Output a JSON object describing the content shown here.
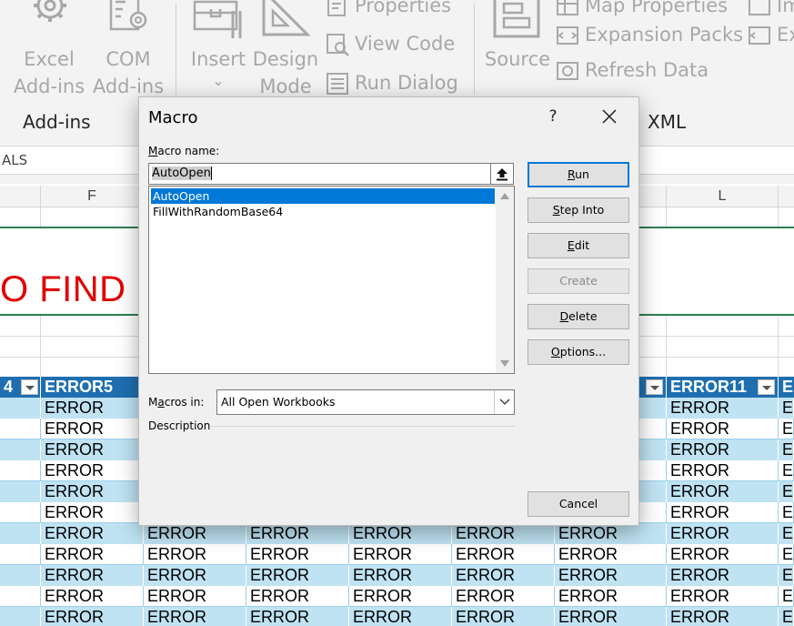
{
  "ribbon": {
    "big_buttons": [
      {
        "line1": "Excel",
        "line2": "Add-ins",
        "icon": "gear-icon"
      },
      {
        "line1": "COM",
        "line2": "Add-ins",
        "icon": "com-gear-icon"
      },
      {
        "line1": "Insert",
        "line2": "⌄",
        "icon": "toolbox-icon"
      },
      {
        "line1": "Design",
        "line2": "Mode",
        "icon": "design-mode-icon"
      },
      {
        "line1": "Source",
        "line2": "",
        "icon": "xml-source-icon"
      }
    ],
    "small_buttons": {
      "properties": "Properties",
      "view_code": "View Code",
      "run_dialog": "Run Dialog",
      "map_properties": "Map Properties",
      "expansion_packs": "Expansion Packs",
      "refresh_data": "Refresh Data",
      "import_partial": "Im",
      "export_partial": "Ex"
    },
    "groups": {
      "addins": "Add-ins",
      "xml": "XML"
    }
  },
  "formula_bar": {
    "value": "ALS"
  },
  "columns": [
    "F",
    "L"
  ],
  "sheet": {
    "big_text": "O FIND I",
    "table_headers": [
      "4",
      "ERROR5",
      "ERROR11",
      "E"
    ],
    "cell_value": "ERROR",
    "edge_cell": "E"
  },
  "dialog": {
    "title": "Macro",
    "help": "?",
    "macro_name_label_u": "M",
    "macro_name_label_rest": "acro name:",
    "macro_name_value": "AutoOpen",
    "macros": [
      "AutoOpen",
      "FillWithRandomBase64"
    ],
    "selected_index": 0,
    "buttons": {
      "run_u": "R",
      "run_rest": "un",
      "step_into_u": "S",
      "step_into_rest": "tep Into",
      "edit_u": "E",
      "edit_rest": "dit",
      "create": "Create",
      "delete_u": "D",
      "delete_rest": "elete",
      "options_u": "O",
      "options_rest": "ptions...",
      "cancel": "Cancel"
    },
    "macros_in_label_pre": "M",
    "macros_in_label_u": "a",
    "macros_in_label_rest": "cros in:",
    "macros_in_value": "All Open Workbooks",
    "description_label": "Description"
  }
}
